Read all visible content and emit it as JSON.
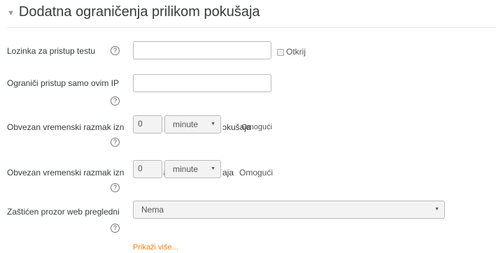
{
  "section": {
    "title": "Dodatna ograničenja prilikom pokušaja",
    "collapse_icon": "caret-down-icon"
  },
  "fields": {
    "password": {
      "label": "Lozinka za pristup testu",
      "value": "",
      "reveal_label": "Otkrij"
    },
    "ip": {
      "label": "Ograniči pristup samo ovim IP",
      "value": ""
    },
    "delay1": {
      "label": "Obvezan vremenski razmak izn",
      "value": "0",
      "unit": "minute",
      "suffix": "ɔkušaja",
      "enable_label": "Omogući",
      "overlap": "Ɔ"
    },
    "delay2": {
      "label": "Obvezan vremenski razmak izn",
      "value": "0",
      "partial": "a",
      "unit": "minute",
      "suffix": "aja",
      "enable_label": "Omogući"
    },
    "browser": {
      "label": "Zaštićen prozor web pregledni",
      "value": "Nema"
    }
  },
  "show_more": "Prikaži više...",
  "icons": {
    "help": "help-icon",
    "dropdown": "dropdown-arrow-icon",
    "checkbox": "checkbox-icon"
  }
}
